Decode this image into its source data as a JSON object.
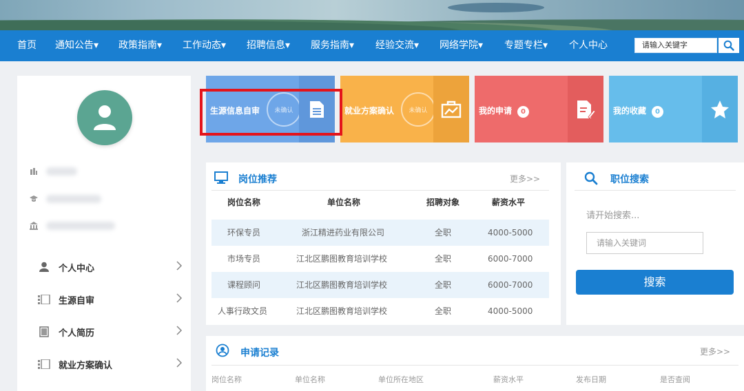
{
  "banner": {},
  "nav": {
    "items": [
      "首页",
      "通知公告▾",
      "政策指南▾",
      "工作动态▾",
      "招聘信息▾",
      "服务指南▾",
      "经验交流▾",
      "网络学院▾",
      "专题专栏▾",
      "个人中心"
    ],
    "search_placeholder": "请输入关键字"
  },
  "sidebar": {
    "menu": [
      {
        "label": "个人中心",
        "icon": "user-icon"
      },
      {
        "label": "生源自审",
        "icon": "list-icon"
      },
      {
        "label": "个人简历",
        "icon": "document-icon"
      },
      {
        "label": "就业方案确认",
        "icon": "list-icon"
      }
    ]
  },
  "cards": [
    {
      "label": "生源信息自审",
      "stamp": "未确认",
      "color": "#6ea6e8",
      "right_color": "#5f97db",
      "icon": "document-icon"
    },
    {
      "label": "就业方案确认",
      "stamp": "未确认",
      "color": "#f9b24a",
      "right_color": "#eda33b",
      "icon": "briefcase-chart-icon"
    },
    {
      "label": "我的申请",
      "badge": "0",
      "color": "#ee6b6b",
      "right_color": "#e35d5d",
      "icon": "edit-document-icon"
    },
    {
      "label": "我的收藏",
      "badge": "0",
      "color": "#66bdeb",
      "right_color": "#56b0e2",
      "icon": "star-icon"
    }
  ],
  "jobs": {
    "title": "岗位推荐",
    "more": "更多>>",
    "headers": [
      "岗位名称",
      "单位名称",
      "招聘对象",
      "薪资水平"
    ],
    "rows": [
      [
        "环保专员",
        "浙江精进药业有限公司",
        "全职",
        "4000-5000"
      ],
      [
        "市场专员",
        "江北区鹏图教育培训学校",
        "全职",
        "6000-7000"
      ],
      [
        "课程顾问",
        "江北区鹏图教育培训学校",
        "全职",
        "6000-7000"
      ],
      [
        "人事行政文员",
        "江北区鹏图教育培训学校",
        "全职",
        "4000-5000"
      ]
    ]
  },
  "job_search": {
    "title": "职位搜索",
    "hint": "请开始搜索...",
    "placeholder": "请输入关键词",
    "button": "搜索"
  },
  "records": {
    "title": "申请记录",
    "more": "更多>>",
    "headers": [
      "岗位名称",
      "单位名称",
      "单位所在地区",
      "薪资水平",
      "发布日期",
      "是否查阅"
    ]
  },
  "colors": {
    "primary": "#1a7fd1",
    "highlight": "#e4141b"
  }
}
